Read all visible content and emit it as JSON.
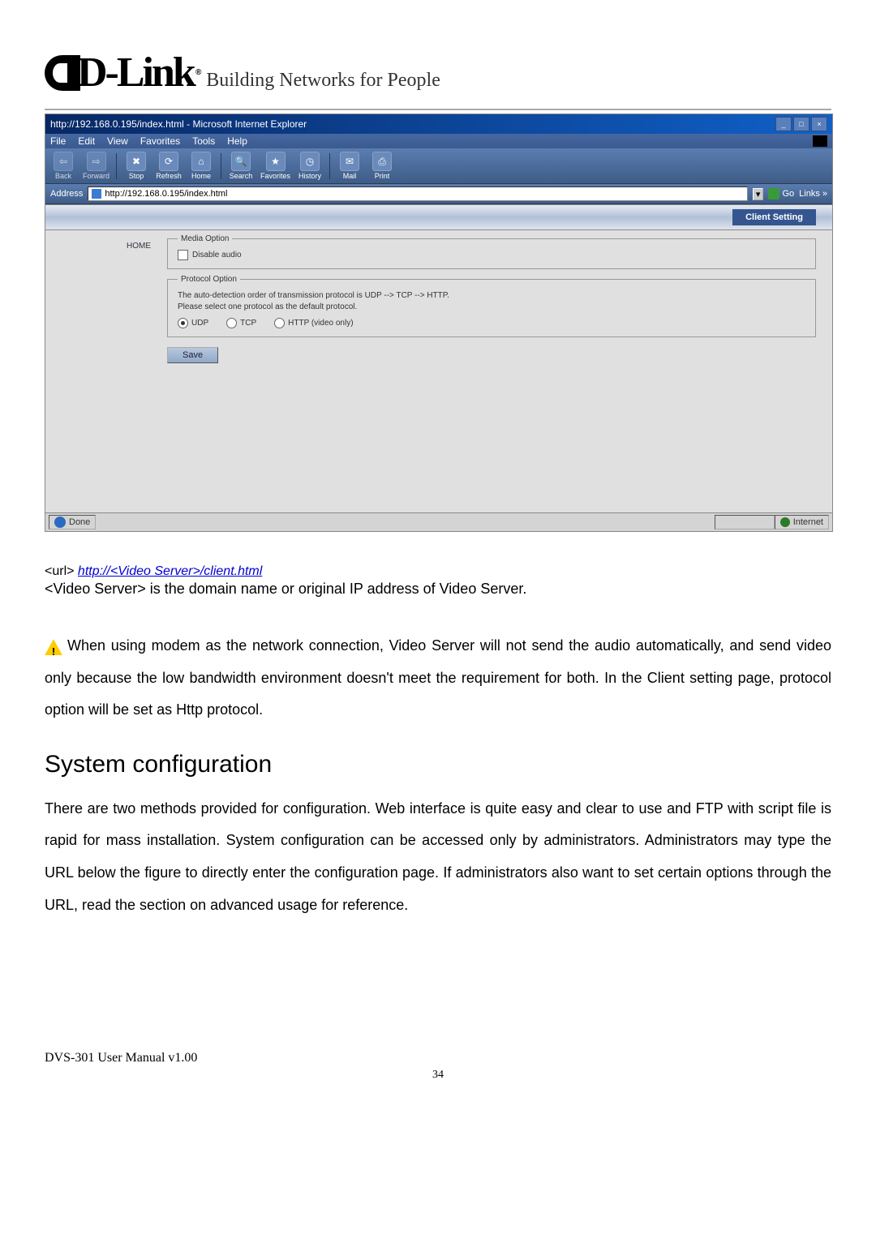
{
  "brand": {
    "logo_text": "D-Link",
    "registered": "®",
    "tagline": "Building Networks for People"
  },
  "browser": {
    "title": "http://192.168.0.195/index.html - Microsoft Internet Explorer",
    "menu": {
      "file": "File",
      "edit": "Edit",
      "view": "View",
      "favorites": "Favorites",
      "tools": "Tools",
      "help": "Help"
    },
    "toolbar": {
      "back": "Back",
      "forward": "Forward",
      "stop": "Stop",
      "refresh": "Refresh",
      "home": "Home",
      "search": "Search",
      "favorites": "Favorites",
      "history": "History",
      "mail": "Mail",
      "print": "Print"
    },
    "address_label": "Address",
    "address_value": "http://192.168.0.195/index.html",
    "go_label": "Go",
    "links_label": "Links »"
  },
  "page": {
    "tab_label": "Client Setting",
    "home_link": "HOME",
    "media_legend": "Media Option",
    "disable_audio": "Disable audio",
    "protocol_legend": "Protocol Option",
    "protocol_text1": "The auto-detection order of transmission protocol is UDP --> TCP --> HTTP.",
    "protocol_text2": "Please select one protocol as the default protocol.",
    "radio_udp": "UDP",
    "radio_tcp": "TCP",
    "radio_http": "HTTP (video only)",
    "save": "Save"
  },
  "status": {
    "done": "Done",
    "zone": "Internet"
  },
  "doc": {
    "url_prefix": "<url> ",
    "url_link": "http://<Video Server>/client.html",
    "url_desc": "<Video Server> is the domain name or original IP address of Video Server.",
    "warn_para": "When using modem as the network connection, Video Server will not send the audio automatically, and send video only because the low bandwidth environment doesn't meet the requirement for both. In the Client setting page, protocol option will be set as Http protocol.",
    "heading": "System configuration",
    "para2": "There are two methods provided for configuration. Web interface is quite easy and clear to use and FTP with script file is rapid for mass installation. System configuration can be accessed only by administrators. Administrators may type the URL below the figure to directly enter the configuration page. If administrators also want to set certain options through the URL, read the section on advanced usage for reference.",
    "footer": "DVS-301 User Manual v1.00",
    "page_number": "34"
  }
}
